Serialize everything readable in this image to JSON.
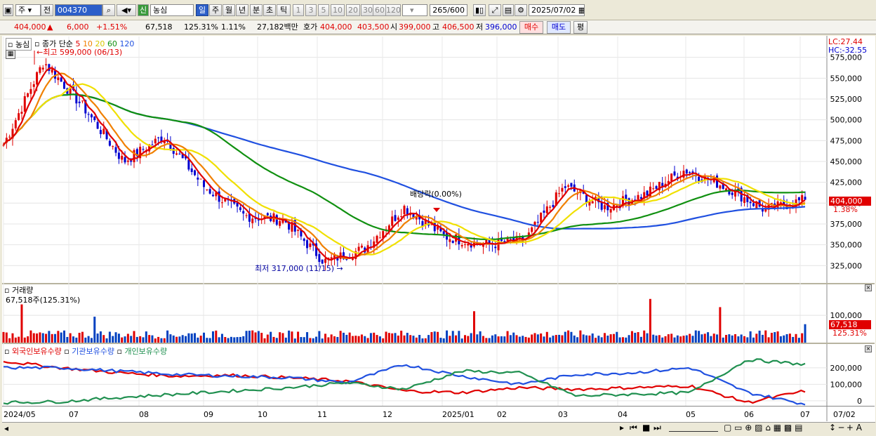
{
  "toolbar": {
    "market": "주",
    "prev_label": "전",
    "code": "004370",
    "new_badge": "신",
    "name": "농심",
    "period_tabs": [
      "일",
      "주",
      "월",
      "년",
      "분",
      "초",
      "틱"
    ],
    "interval_buttons": [
      "1",
      "3",
      "5",
      "10",
      "20",
      "30",
      "60",
      "120"
    ],
    "count": "265",
    "count_total": "/600",
    "date": "2025/07/02"
  },
  "quote": {
    "price": "404,000",
    "arrow": "▲",
    "change": "6,000",
    "change_pct": "+1.51%",
    "volume": "67,518",
    "volume_ratio": "125.31%",
    "turnover_pct": "1.11%",
    "amount": "27,182백만",
    "bid_label": "호가",
    "bid": "404,000",
    "ask": "403,500",
    "open_label": "시",
    "open": "399,000",
    "high_label": "고",
    "high": "406,500",
    "low_label": "저",
    "low": "396,000",
    "buy_label": "매수",
    "sell_label": "매도",
    "eval_label": "평"
  },
  "price_panel": {
    "stock_tag": "농심",
    "ma_title": "종가 단순",
    "ma_periods": [
      "5",
      "10",
      "20",
      "60",
      "120"
    ],
    "high_marker": "최고 599,000 (06/13)",
    "low_marker": "최저 317,000 (11/15)",
    "dividend_marker": "배당락(0.00%)",
    "lc": "LC:27.44",
    "hc": "HC:-32.55",
    "current_price_tag": "404,000",
    "current_pct_tag": "1.38%"
  },
  "volume_panel": {
    "title": "거래량",
    "readout": "67,518주(125.31%)",
    "current_tag": "67,518",
    "current_pct_tag": "125.31%"
  },
  "holding_panel": {
    "series_labels": [
      "외국인보유수량",
      "기관보유수량",
      "개인보유수량"
    ]
  },
  "x_labels": [
    "2024/05",
    "07",
    "08",
    "09",
    "10",
    "11",
    "12",
    "2025/01",
    "02",
    "03",
    "04",
    "05",
    "06",
    "07",
    "07/02"
  ],
  "chart_data": [
    {
      "type": "candlestick",
      "title": "농심 일봉",
      "y_ticks": [
        325000,
        350000,
        375000,
        400000,
        425000,
        450000,
        475000,
        500000,
        525000,
        550000,
        575000
      ],
      "ylim": [
        305000,
        600000
      ],
      "anchors": [
        {
          "date": "2024/05",
          "close": 470000
        },
        {
          "date": "2024/06/13",
          "close": 570000
        },
        {
          "date": "2024/07",
          "close": 515000
        },
        {
          "date": "2024/07 mid",
          "close": 450000
        },
        {
          "date": "2024/08",
          "close": 480000
        },
        {
          "date": "2024/08 mid",
          "close": 420000
        },
        {
          "date": "2024/09",
          "close": 385000
        },
        {
          "date": "2024/10",
          "close": 380000
        },
        {
          "date": "2024/11/15",
          "close": 330000
        },
        {
          "date": "2024/12",
          "close": 345000
        },
        {
          "date": "2024/12 end",
          "close": 395000
        },
        {
          "date": "2025/01",
          "close": 360000
        },
        {
          "date": "2025/02",
          "close": 350000
        },
        {
          "date": "2025/03",
          "close": 355000
        },
        {
          "date": "2025/03 mid",
          "close": 420000
        },
        {
          "date": "2025/04",
          "close": 395000
        },
        {
          "date": "2025/05",
          "close": 410000
        },
        {
          "date": "2025/05 mid",
          "close": 440000
        },
        {
          "date": "2025/06",
          "close": 420000
        },
        {
          "date": "2025/06 end",
          "close": 392000
        },
        {
          "date": "2025/07/02",
          "close": 404000
        }
      ],
      "colors": {
        "up": "#e00000",
        "down": "#0000d0",
        "ma5": "#e00000",
        "ma10": "#f08000",
        "ma20": "#f0e000",
        "ma60": "#109010",
        "ma120": "#2050e0"
      }
    },
    {
      "type": "bar",
      "title": "거래량",
      "y_ticks": [
        100000
      ],
      "ylim": [
        0,
        180000
      ],
      "peaks": [
        {
          "date": "2024/06/13",
          "value": 140000
        },
        {
          "date": "2025/03",
          "value": 115000
        },
        {
          "date": "2025/05",
          "value": 160000
        },
        {
          "date": "2025/06",
          "value": 130000
        },
        {
          "date": "2025/07/02",
          "value": 67518
        }
      ]
    },
    {
      "type": "line",
      "title": "보유수량",
      "y_ticks": [
        0,
        100000,
        200000
      ],
      "ylim": [
        -30000,
        280000
      ],
      "series": [
        {
          "name": "외국인보유수량",
          "color": "#e00000",
          "values": [
            240000,
            200000,
            170000,
            150000,
            155000,
            140000,
            120000,
            60000,
            50000,
            80000,
            70000,
            80000,
            90000,
            -10000,
            60000
          ]
        },
        {
          "name": "기관보유수량",
          "color": "#2050e0",
          "values": [
            200000,
            200000,
            180000,
            160000,
            150000,
            140000,
            110000,
            220000,
            150000,
            100000,
            160000,
            170000,
            200000,
            50000,
            -20000
          ]
        },
        {
          "name": "개인보유수량",
          "color": "#209050",
          "values": [
            -10000,
            -5000,
            20000,
            40000,
            60000,
            80000,
            110000,
            70000,
            180000,
            170000,
            30000,
            40000,
            50000,
            250000,
            220000
          ]
        }
      ]
    }
  ]
}
